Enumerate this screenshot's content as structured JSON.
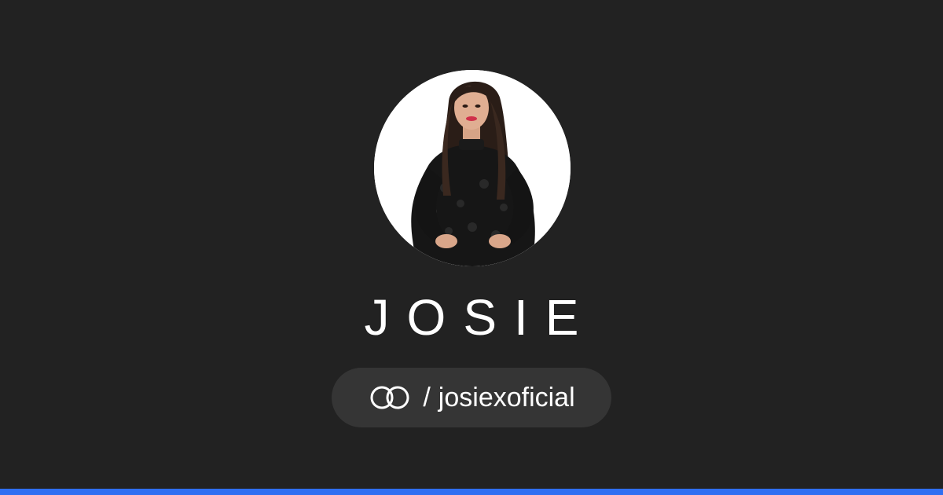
{
  "profile": {
    "name": "JOSIE",
    "separator": "/",
    "handle": "josiexoficial"
  },
  "icons": {
    "brand_logo": "linked-rings-icon",
    "avatar": "profile-photo"
  },
  "colors": {
    "background": "#222222",
    "pill": "#353535",
    "text": "#ffffff",
    "accent": "#2f6ff2"
  }
}
